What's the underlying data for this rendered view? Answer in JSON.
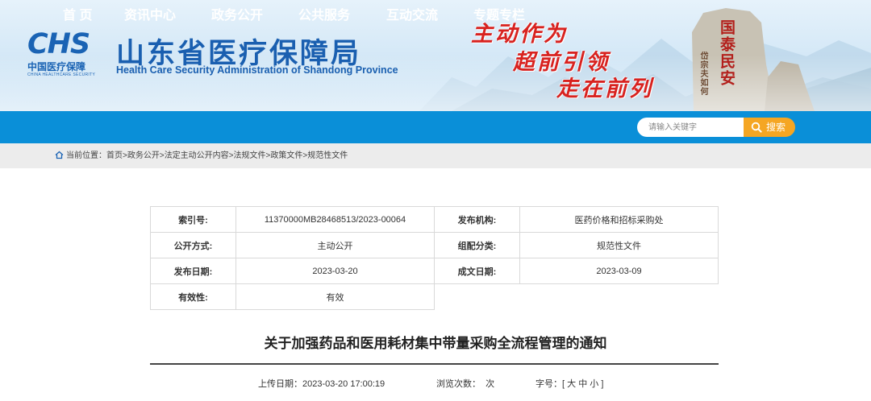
{
  "logo": {
    "mark": "CHS",
    "cn": "中国医疗保障",
    "en": "CHINA HEALTHCARE SECURITY"
  },
  "header": {
    "title_cn": "山东省医疗保障局",
    "title_en": "Health Care Security Administration of Shandong Province",
    "slogan": [
      "主动作为",
      "超前引领",
      "走在前列"
    ],
    "stele_big": "国泰民安",
    "stele_small": "岱宗夫如何"
  },
  "nav": {
    "items": [
      "首  页",
      "资讯中心",
      "政务公开",
      "公共服务",
      "互动交流",
      "专题专栏"
    ],
    "search_placeholder": "请输入关键字",
    "search_label": "搜索"
  },
  "breadcrumb": {
    "prefix": "当前位置：",
    "items": [
      "首页",
      "政务公开",
      "法定主动公开内容",
      "法规文件",
      "政策文件",
      "规范性文件"
    ],
    "sep": ">"
  },
  "info": {
    "index_no_label": "索引号:",
    "index_no": "11370000MB28468513/2023-00064",
    "publisher_label": "发布机构:",
    "publisher": "医药价格和招标采购处",
    "open_mode_label": "公开方式:",
    "open_mode": "主动公开",
    "category_label": "组配分类:",
    "category": "规范性文件",
    "publish_date_label": "发布日期:",
    "publish_date": "2023-03-20",
    "written_date_label": "成文日期:",
    "written_date": "2023-03-09",
    "validity_label": "有效性:",
    "validity": "有效"
  },
  "document": {
    "title": "关于加强药品和医用耗材集中带量采购全流程管理的通知",
    "upload_label": "上传日期：",
    "upload_date": "2023-03-20 17:00:19",
    "views_label": "浏览次数：",
    "views_unit": "次",
    "font_label": "字号：",
    "font_open": "[",
    "font_big": "大",
    "font_mid": "中",
    "font_small": "小",
    "font_close": "]"
  },
  "colors": {
    "nav_bg": "#0a8fd8",
    "brand_blue": "#1a5fb0",
    "slogan_red": "#d8221f",
    "search_btn": "#f5a623",
    "crumb_bg": "#ececec"
  }
}
